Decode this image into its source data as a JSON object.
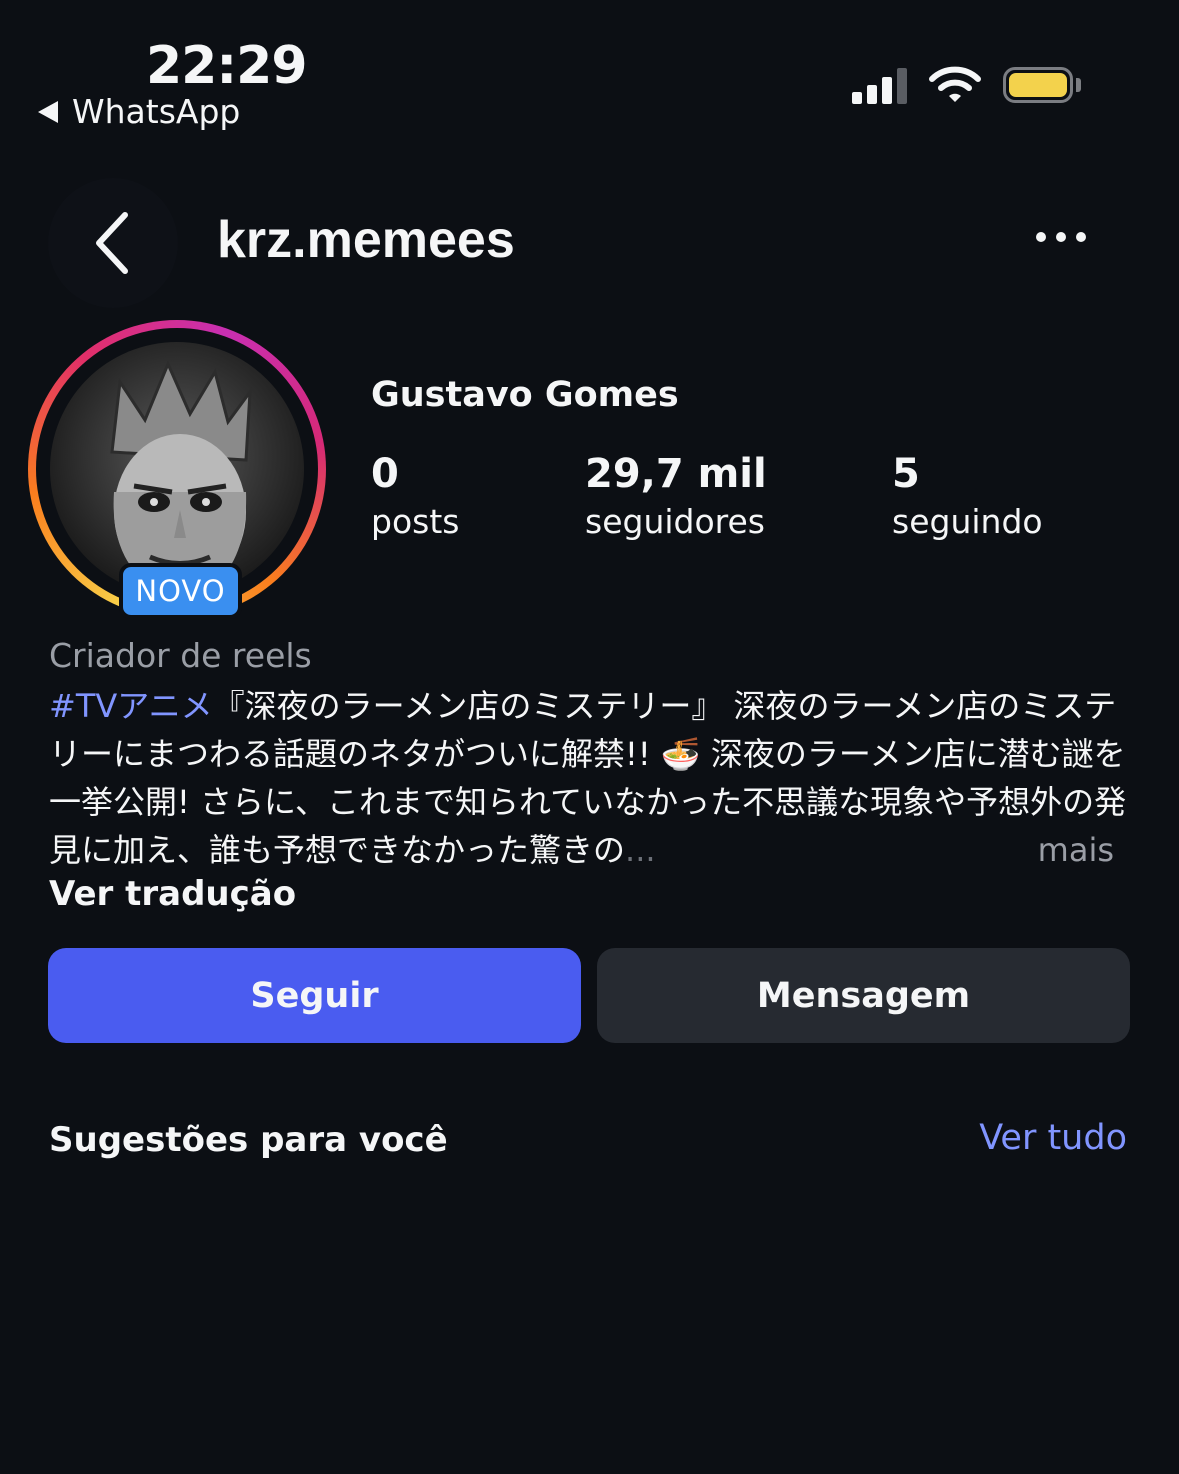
{
  "status_bar": {
    "time": "22:29",
    "back_app": "WhatsApp"
  },
  "header": {
    "username": "krz.memees"
  },
  "profile": {
    "display_name": "Gustavo Gomes",
    "badge": "NOVO",
    "stats": [
      {
        "value": "0",
        "label": "posts"
      },
      {
        "value": "29,7 mil",
        "label": "seguidores"
      },
      {
        "value": "5",
        "label": "seguindo"
      }
    ],
    "category": "Criador de reels",
    "bio_hashtag": "#TVアニメ",
    "bio_text": "『深夜のラーメン店のミステリー』 深夜のラーメン店のミステリーにまつわる話題のネタがついに解禁!! 🍜 深夜のラーメン店に潜む謎を一挙公開! さらに、これまで知られていなかった不思議な現象や予想外の発見に加え、誰も予想できなかった驚きの",
    "bio_ellipsis": "...",
    "bio_more": "mais",
    "translate": "Ver tradução"
  },
  "actions": {
    "follow": "Seguir",
    "message": "Mensagem"
  },
  "suggestions": {
    "title": "Sugestões para você",
    "see_all": "Ver tudo"
  },
  "colors": {
    "accent": "#4a5cf0",
    "link": "#8195ff",
    "badge": "#3a8ff0",
    "battery": "#f3d24c"
  }
}
